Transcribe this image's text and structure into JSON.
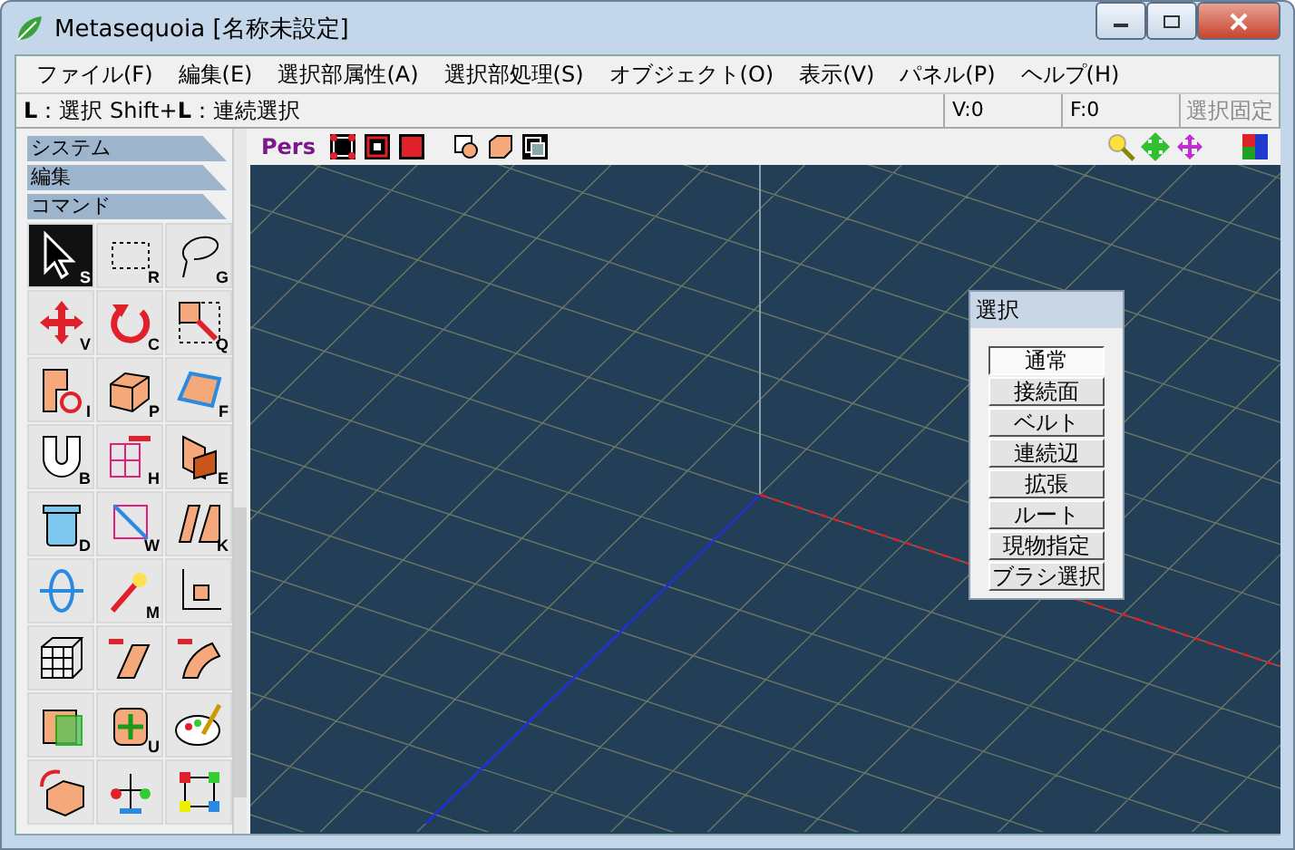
{
  "window": {
    "title": "Metasequoia [名称未設定]"
  },
  "menu": [
    "ファイル(F)",
    "編集(E)",
    "選択部属性(A)",
    "選択部処理(S)",
    "オブジェクト(O)",
    "表示(V)",
    "パネル(P)",
    "ヘルプ(H)"
  ],
  "status_bar": {
    "hint": "**L**：選択  Shift+**L**：連続選択",
    "vertices": "V:0",
    "faces": "F:0",
    "lock_button": {
      "label": "選択固定",
      "disabled": true
    }
  },
  "sidebar": {
    "sections": [
      "システム",
      "編集",
      "コマンド"
    ],
    "tools": [
      {
        "kind": "pointer",
        "key": "S",
        "selected": true
      },
      {
        "kind": "rect",
        "key": "R",
        "selected": false
      },
      {
        "kind": "lasso",
        "key": "G",
        "selected": false
      },
      {
        "kind": "move",
        "key": "V",
        "selected": false
      },
      {
        "kind": "rotate",
        "key": "C",
        "selected": false
      },
      {
        "kind": "scale",
        "key": "Q",
        "selected": false
      },
      {
        "kind": "face",
        "key": "I",
        "selected": false
      },
      {
        "kind": "cube",
        "key": "P",
        "selected": false
      },
      {
        "kind": "quad",
        "key": "F",
        "selected": false
      },
      {
        "kind": "magnet",
        "key": "B",
        "selected": false
      },
      {
        "kind": "grid",
        "key": "H",
        "selected": false
      },
      {
        "kind": "split",
        "key": "E",
        "selected": false
      },
      {
        "kind": "trash",
        "key": "D",
        "selected": false
      },
      {
        "kind": "edge",
        "key": "W",
        "selected": false
      },
      {
        "kind": "knife",
        "key": "K",
        "selected": false
      },
      {
        "kind": "orbit",
        "selected": false
      },
      {
        "kind": "wand",
        "key": "M",
        "selected": false
      },
      {
        "kind": "axis",
        "selected": false
      },
      {
        "kind": "lattice",
        "selected": false
      },
      {
        "kind": "bend",
        "selected": false
      },
      {
        "kind": "curve",
        "selected": false
      },
      {
        "kind": "cylinder",
        "selected": false
      },
      {
        "kind": "stretch",
        "key": "U",
        "selected": false
      },
      {
        "kind": "palette",
        "selected": false
      },
      {
        "kind": "box",
        "selected": false
      },
      {
        "kind": "balance",
        "selected": false
      },
      {
        "kind": "nodes",
        "selected": false
      }
    ]
  },
  "viewport": {
    "view_label": "Pers",
    "select_panel": {
      "title": "選択",
      "buttons": [
        {
          "label": "通常",
          "selected": true
        },
        {
          "label": "接続面",
          "selected": false
        },
        {
          "label": "ベルト",
          "selected": false
        },
        {
          "label": "連続辺",
          "selected": false
        },
        {
          "label": "拡張",
          "selected": false
        },
        {
          "label": "ルート",
          "selected": false
        },
        {
          "label": "現物指定",
          "selected": false
        },
        {
          "label": "ブラシ選択",
          "selected": false
        }
      ]
    }
  }
}
